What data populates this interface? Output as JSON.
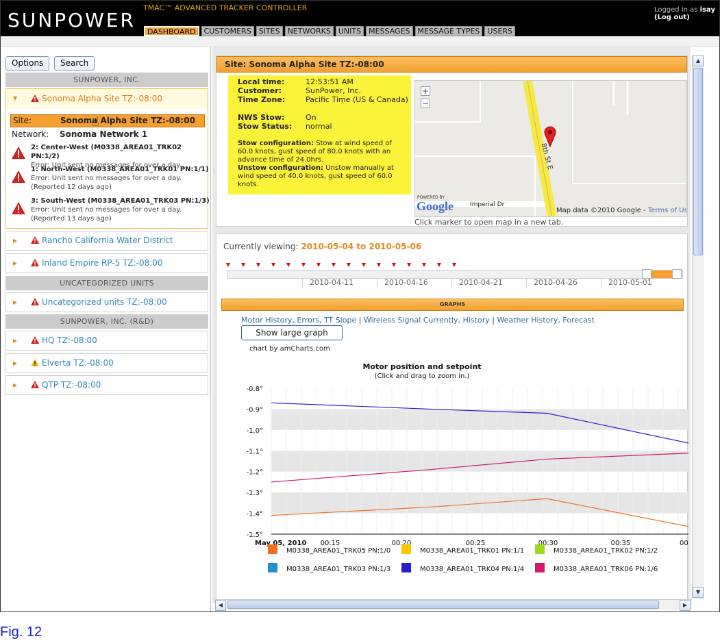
{
  "header": {
    "logo": "SUNPOWER",
    "app_title": "TMAC™ ADVANCED TRACKER CONTROLLER",
    "tabs": [
      "DASHBOARD",
      "CUSTOMERS",
      "SITES",
      "NETWORKS",
      "UNITS",
      "MESSAGES",
      "MESSAGE TYPES",
      "USERS"
    ],
    "logged_in_prefix": "Logged in as",
    "username": "isay",
    "logout": "(Log out)"
  },
  "sidebar": {
    "options_label": "Options",
    "search_label": "Search",
    "group1": "SUNPOWER, INC.",
    "expanded_site": "Sonoma Alpha Site TZ:-08:00",
    "site_label": "Site:",
    "site_value": "Sonoma Alpha Site TZ:-08:00",
    "network_label": "Network:",
    "network_value": "Sonoma Network 1",
    "alerts": [
      {
        "title": "2: Center-West (M0338_AREA01_TRK02 PN:1/2)",
        "text": "Error: Unit sent no messages for over a day."
      },
      {
        "title": "1: North-West (M0338_AREA01_TRK01 PN:1/1)",
        "text": "Error: Unit sent no messages for over a day.",
        "note": "(Reported 12 days ago)"
      },
      {
        "title": "3: South-West (M0338_AREA01_TRK03 PN:1/3)",
        "text": "Error: Unit sent no messages for over a day.",
        "note": "(Reported 13 days ago)"
      }
    ],
    "sites1": [
      "Rancho California Water District TZ:-08:00",
      "Inland Empire RP-5 TZ:-08:00"
    ],
    "group2": "UNCATEGORIZED UNITS",
    "sites2": [
      "Uncategorized units TZ:-08:00"
    ],
    "group3": "SUNPOWER, INC. (R&D)",
    "sites3": [
      "HQ TZ:-08:00",
      "Elverta TZ:-08:00",
      "QTP TZ:-08:00"
    ]
  },
  "site_panel": {
    "header": "Site: Sonoma Alpha Site TZ:-08:00",
    "local_time_k": "Local time:",
    "local_time_v": "12:53:51 AM",
    "customer_k": "Customer:",
    "customer_v": "SunPower, Inc.",
    "tz_k": "Time Zone:",
    "tz_v": "Pacific Time (US & Canada)",
    "nws_k": "NWS Stow:",
    "nws_v": "On",
    "stow_k": "Stow Status:",
    "stow_v": "normal",
    "stow_cfg_k": "Stow configuration:",
    "stow_cfg_v": "Stow at wind speed of 60.0 knots, gust speed of 80.0 knots with an advance time of 24.0hrs.",
    "unstow_cfg_k": "Unstow configuration:",
    "unstow_cfg_v": "Unstow manually at wind speed of 40.0 knots, gust speed of 60.0 knots.",
    "map_street": "8th St E",
    "map_road": "Imperial Dr",
    "map_powered": "POWERED BY",
    "map_google": "Google",
    "map_data": "Map data ©2010 Google -",
    "map_terms": "Terms of Use",
    "map_note": "Click marker to open map in a new tab."
  },
  "graph_panel": {
    "viewing_prefix": "Currently viewing:",
    "viewing_range": "2010-05-04 to 2010-05-06",
    "timeline_labels": [
      "2010-04-11",
      "2010-04-16",
      "2010-04-21",
      "2010-04-26",
      "2010-05-01"
    ],
    "graphs_header": "GRAPHS",
    "links_prefix": "Motor History, Errors, TT Slope",
    "links_mid": "Wireless Signal Currently, History",
    "links_end": "Weather History, Forecast",
    "large_graph": "Show large graph",
    "amcharts": "chart by amCharts.com"
  },
  "chart_data": {
    "type": "line",
    "title": "Motor position and setpoint",
    "subtitle": "(Click and drag to zoom in.)",
    "x_labels": [
      "May 05, 2010",
      "00:15",
      "00:20",
      "00:25",
      "00:30",
      "00:35",
      "00:"
    ],
    "y_ticks": [
      "-0.8°",
      "-0.9°",
      "-1.0°",
      "-1.1°",
      "-1.2°",
      "-1.3°",
      "-1.4°",
      "-1.5°"
    ],
    "ylim": [
      -1.5,
      -0.8
    ],
    "x": [
      0,
      15,
      26,
      40
    ],
    "series": [
      {
        "name": "M0338_AREA01_TRK05 PN:1/0",
        "color": "#f07020",
        "values": [
          -1.41,
          -1.37,
          -1.33,
          -1.47
        ]
      },
      {
        "name": "M0338_AREA01_TRK01 PN:1/1",
        "color": "#f8c800",
        "values": []
      },
      {
        "name": "M0338_AREA01_TRK02 PN:1/2",
        "color": "#a0d820",
        "values": []
      },
      {
        "name": "M0338_AREA01_TRK03 PN:1/3",
        "color": "#2090d0",
        "values": []
      },
      {
        "name": "M0338_AREA01_TRK04 PN:1/4",
        "color": "#2a1ad0",
        "values": [
          -0.87,
          -0.9,
          -0.92,
          -1.07
        ]
      },
      {
        "name": "M0338_AREA01_TRK06 PN:1/6",
        "color": "#d01870",
        "values": [
          -1.25,
          -1.19,
          -1.14,
          -1.11
        ]
      }
    ]
  },
  "caption": "Fig. 12"
}
